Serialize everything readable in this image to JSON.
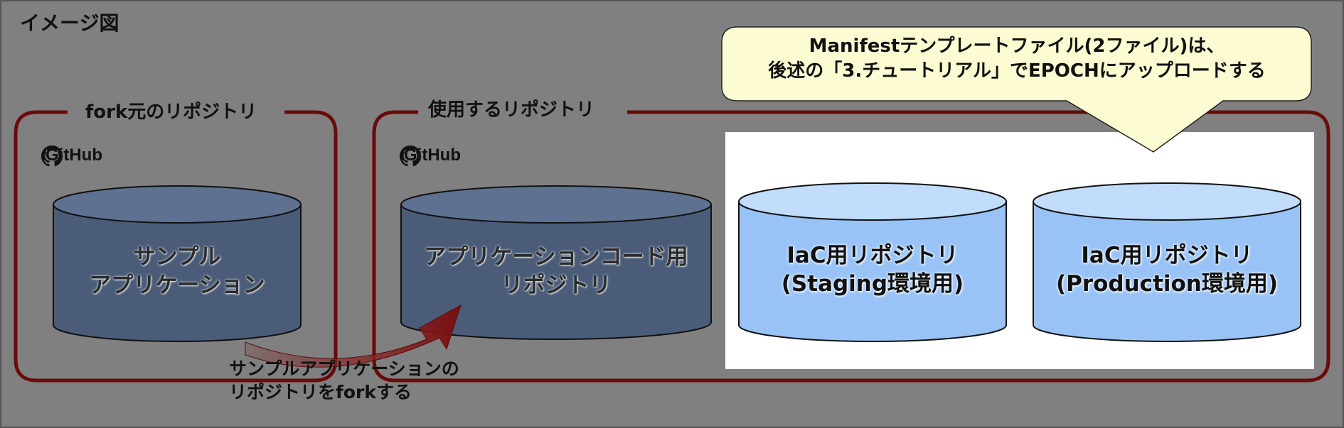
{
  "title": "イメージ図",
  "groups": {
    "fork_source": {
      "label": "fork元のリポジトリ",
      "provider": "GitHub"
    },
    "used": {
      "label": "使用するリポジトリ",
      "provider": "GitHub"
    }
  },
  "repositories": {
    "sample_app": {
      "line1": "サンプル",
      "line2": "アプリケーション"
    },
    "app_code": {
      "line1": "アプリケーションコード用",
      "line2": "リポジトリ"
    },
    "iac_staging": {
      "line1": "IaC用リポジトリ",
      "line2": "(Staging環境用)"
    },
    "iac_production": {
      "line1": "IaC用リポジトリ",
      "line2": "(Production環境用)"
    }
  },
  "fork_arrow": {
    "line1": "サンプルアプリケーションの",
    "line2": "リポジトリをforkする"
  },
  "callout": {
    "line1": "Manifestテンプレートファイル(2ファイル)は、",
    "line2": "後述の「3.チュートリアル」でEPOCHにアップロードする"
  },
  "colors": {
    "background": "#808080",
    "group_border": "#6b0a0a",
    "dark_cylinder": "#4a5c78",
    "light_cylinder": "#99c3f7",
    "callout_fill": "#fdfbd2",
    "arrow": "#7a1515"
  },
  "icons": [
    "github-icon"
  ]
}
